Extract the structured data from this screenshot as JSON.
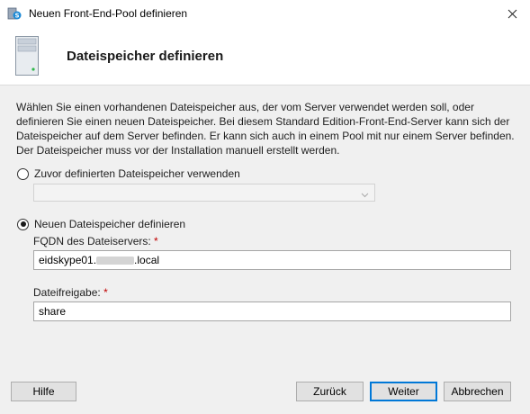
{
  "window": {
    "title": "Neuen Front-End-Pool definieren",
    "icons": {
      "app": "skype-server-icon",
      "close": "close-icon"
    }
  },
  "header": {
    "title": "Dateispeicher definieren",
    "icon": "server-icon"
  },
  "content": {
    "description_lines": [
      "Wählen Sie einen vorhandenen Dateispeicher aus, der vom Server verwendet werden soll, oder",
      "definieren Sie einen neuen Dateispeicher. Bei diesem Standard Edition-Front-End-Server kann sich der",
      "Dateispeicher auf dem Server befinden. Er kann sich auch in einem Pool mit nur einem Server befinden.",
      "Der Dateispeicher muss vor der Installation manuell erstellt werden."
    ],
    "option_existing": {
      "label": "Zuvor definierten Dateispeicher verwenden",
      "selected": false
    },
    "existing_select": {
      "value": "",
      "enabled": false
    },
    "option_new": {
      "label": "Neuen Dateispeicher definieren",
      "selected": true
    },
    "fqdn": {
      "label": "FQDN des Dateiservers:",
      "required_marker": "*",
      "value_prefix": "eidskype01.",
      "value_suffix": ".local"
    },
    "share": {
      "label": "Dateifreigabe:",
      "required_marker": "*",
      "value": "share"
    }
  },
  "buttons": {
    "help": "Hilfe",
    "back": "Zurück",
    "next": "Weiter",
    "cancel": "Abbrechen"
  }
}
